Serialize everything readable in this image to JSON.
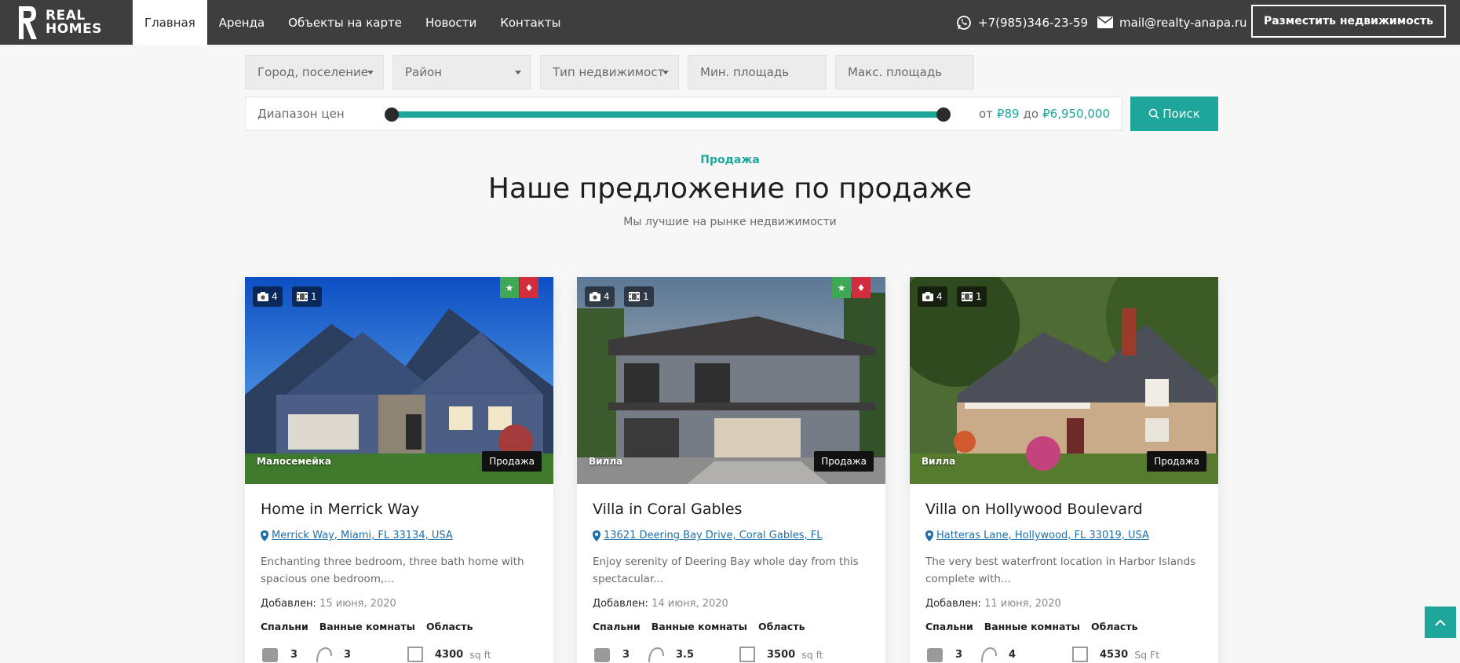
{
  "header": {
    "logo_text_1": "REAL",
    "logo_text_2": "HOMES",
    "nav": [
      {
        "label": "Главная",
        "active": true
      },
      {
        "label": "Аренда"
      },
      {
        "label": "Объекты на карте"
      },
      {
        "label": "Новости"
      },
      {
        "label": "Контакты"
      }
    ],
    "phone": "+7(985)346-23-59",
    "email": "mail@realty-anapa.ru",
    "post_button": "Разместить недвижимость"
  },
  "search": {
    "city": "Город, поселение",
    "district": "Район",
    "type": "Тип недвижимост",
    "min_area": "Мин. площадь",
    "max_area": "Макс. площадь",
    "price_label": "Диапазон цен",
    "price_from_word": "от",
    "price_from": "₽89",
    "price_to_word": "до",
    "price_to": "₽6,950,000",
    "search_button": "Поиск"
  },
  "section": {
    "eyebrow": "Продажа",
    "title": "Наше предложение по продаже",
    "subtitle": "Мы лучшие на рынке недвижимости"
  },
  "labels": {
    "added": "Добавлен:",
    "bedrooms": "Спальни",
    "bathrooms": "Ванные комнаты",
    "area": "Область"
  },
  "cards": [
    {
      "photos": "4",
      "videos": "1",
      "featured": true,
      "hot": true,
      "type": "Малосемейка",
      "status": "Продажа",
      "title": "Home in Merrick Way",
      "address": "Merrick Way, Miami, FL 33134, USA",
      "desc": "Enchanting three bedroom, three bath home with spacious one bedroom,...",
      "date": "15 июня, 2020",
      "bedrooms": "3",
      "bathrooms": "3",
      "area": "4300",
      "unit": "sq ft"
    },
    {
      "photos": "4",
      "videos": "1",
      "featured": true,
      "hot": true,
      "type": "Вилла",
      "status": "Продажа",
      "title": "Villa in Coral Gables",
      "address": "13621 Deering Bay Drive, Coral Gables, FL",
      "desc": "Enjoy serenity of Deering Bay whole day from this spectacular...",
      "date": "14 июня, 2020",
      "bedrooms": "3",
      "bathrooms": "3.5",
      "area": "3500",
      "unit": "sq ft"
    },
    {
      "photos": "4",
      "videos": "1",
      "featured": false,
      "hot": false,
      "type": "Вилла",
      "status": "Продажа",
      "title": "Villa on Hollywood Boulevard",
      "address": "Hatteras Lane, Hollywood, FL 33019, USA",
      "desc": "The very best waterfront location in Harbor Islands complete with...",
      "date": "11 июня, 2020",
      "bedrooms": "3",
      "bathrooms": "4",
      "area": "4530",
      "unit": "Sq Ft"
    }
  ],
  "colors": {
    "accent": "#1ea69a",
    "header_bg": "#3e3e3e",
    "featured": "#3fa855",
    "hot": "#d12d3c"
  }
}
